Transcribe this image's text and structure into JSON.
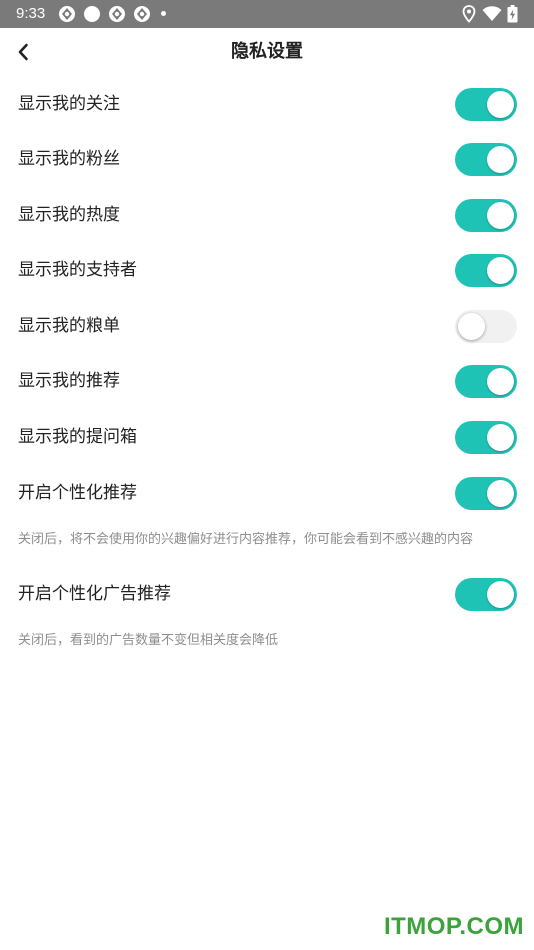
{
  "status_bar": {
    "time": "9:33",
    "icons": [
      "sync-icon",
      "circle-icon",
      "sync-icon",
      "sync-icon",
      "dot-icon",
      "location-icon",
      "wifi-icon",
      "battery-charging-icon"
    ]
  },
  "header": {
    "back_icon": "chevron-left-icon",
    "title": "隐私设置"
  },
  "settings": [
    {
      "label": "显示我的关注",
      "on": true
    },
    {
      "label": "显示我的粉丝",
      "on": true
    },
    {
      "label": "显示我的热度",
      "on": true
    },
    {
      "label": "显示我的支持者",
      "on": true
    },
    {
      "label": "显示我的粮单",
      "on": false
    },
    {
      "label": "显示我的推荐",
      "on": true
    },
    {
      "label": "显示我的提问箱",
      "on": true
    },
    {
      "label": "开启个性化推荐",
      "on": true,
      "hint": "关闭后，将不会使用你的兴趣偏好进行内容推荐，你可能会看到不感兴趣的内容"
    },
    {
      "label": "开启个性化广告推荐",
      "on": true,
      "hint": "关闭后，看到的广告数量不变但相关度会降低"
    }
  ],
  "colors": {
    "accent": "#1ec3b6",
    "toggle_off": "#f1f1f1",
    "status_bar": "#7a7a7a",
    "hint_text": "#8e8e8e"
  },
  "watermark": "ITMOP.COM"
}
